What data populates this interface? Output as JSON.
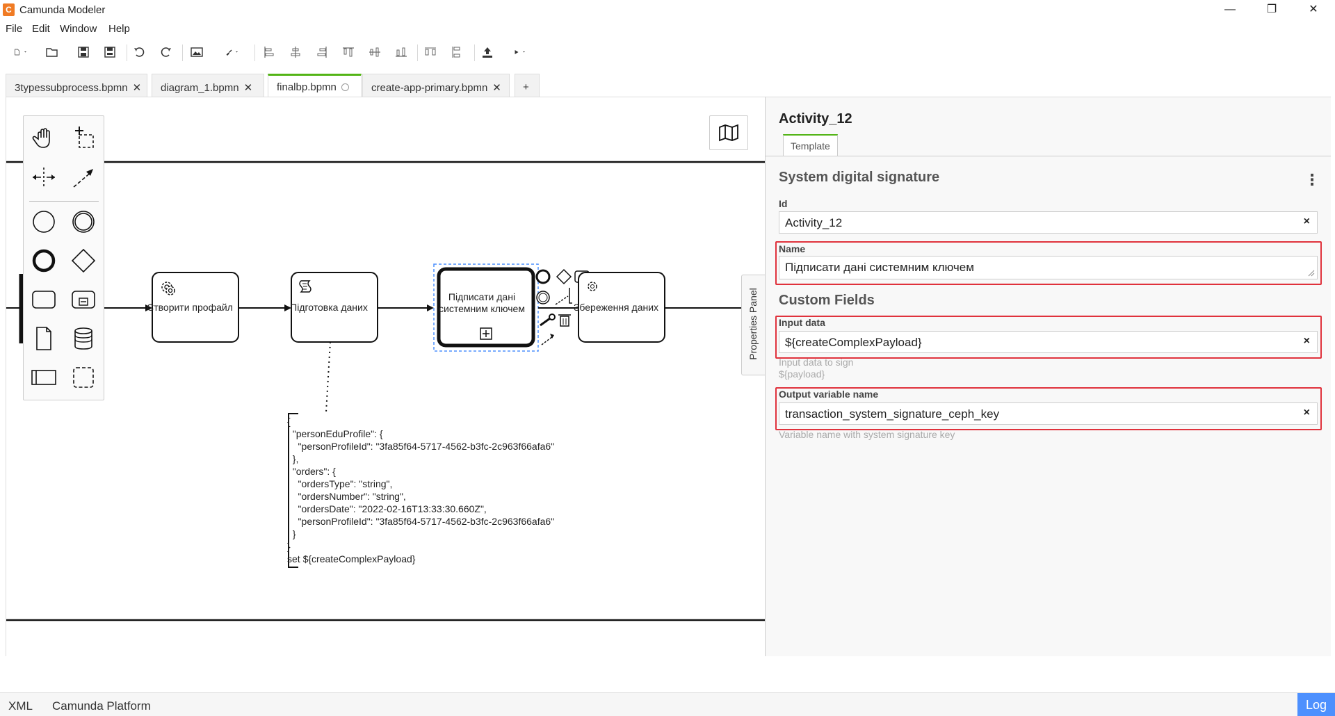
{
  "window": {
    "title": "Camunda Modeler",
    "minimize": "—",
    "maximize": "❐",
    "close": "✕"
  },
  "menu": [
    "File",
    "Edit",
    "Window",
    "Help"
  ],
  "toolbar": {
    "icons": [
      "new-file-icon",
      "open-file-icon",
      "save-icon",
      "save-as-icon",
      "undo-icon",
      "redo-icon",
      "export-image-icon",
      "color-brush-icon",
      "align-left-icon",
      "align-center-icon",
      "align-right-icon",
      "align-top-icon",
      "align-middle-icon",
      "align-bottom-icon",
      "distribute-horizontal-icon",
      "distribute-vertical-icon",
      "deploy-icon",
      "start-instance-icon"
    ]
  },
  "tabs": [
    {
      "label": "3typessubprocess.bpmn",
      "active": false
    },
    {
      "label": "diagram_1.bpmn",
      "active": false
    },
    {
      "label": "finalbp.bpmn",
      "active": true
    },
    {
      "label": "create-app-primary.bpmn",
      "active": false
    }
  ],
  "add_tab": "+",
  "diagram": {
    "tasks": [
      {
        "label": "Створити профайл",
        "type": "service-task"
      },
      {
        "label": "Підготовка даних",
        "type": "script-task"
      },
      {
        "label": "Підписати дані системним ключем",
        "type": "call-activity",
        "selected": true
      },
      {
        "label": "Збереження даних",
        "type": "service-task"
      }
    ],
    "annotation": "{\n  \"personEduProfile\": {\n    \"personProfileId\": \"3fa85f64-5717-4562-b3fc-2c963f66afa6\"\n  },\n  \"orders\": {\n    \"ordersType\": \"string\",\n    \"ordersNumber\": \"string\",\n    \"ordersDate\": \"2022-02-16T13:33:30.660Z\",\n    \"personProfileId\": \"3fa85f64-5717-4562-b3fc-2c963f66afa6\"\n  }\n}\nset ${createComplexPayload}"
  },
  "properties_toggle": "Properties Panel",
  "properties": {
    "element_title": "Activity_12",
    "tab": "Template",
    "template_name": "System digital signature",
    "menu_icon": "⋮",
    "id_label": "Id",
    "id_value": "Activity_12",
    "name_label": "Name",
    "name_value": "Підписати дані системним ключем",
    "custom_fields_title": "Custom Fields",
    "input_label": "Input data",
    "input_value": "${createComplexPayload}",
    "input_desc_1": "Input data to sign",
    "input_desc_2": "${payload}",
    "output_label": "Output variable name",
    "output_value": "transaction_system_signature_ceph_key",
    "output_desc": "Variable name with system signature key",
    "clear_icon": "×"
  },
  "statusbar": {
    "xml": "XML",
    "platform": "Camunda Platform",
    "log": "Log"
  },
  "colors": {
    "accent_green": "#52b415",
    "highlight_red": "#e0323c",
    "log_blue": "#4d90fe",
    "selection_blue": "#4d90fe"
  }
}
